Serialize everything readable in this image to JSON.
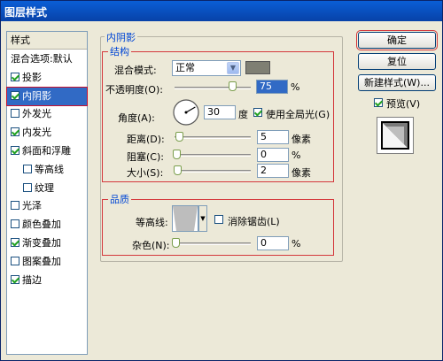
{
  "window": {
    "title": "图层样式"
  },
  "sidebar": {
    "header": "样式",
    "items": [
      {
        "label": "混合选项:默认",
        "checkbox": false,
        "checked": false
      },
      {
        "label": "投影",
        "checkbox": true,
        "checked": true
      },
      {
        "label": "内阴影",
        "checkbox": true,
        "checked": true,
        "selected": true
      },
      {
        "label": "外发光",
        "checkbox": true,
        "checked": false
      },
      {
        "label": "内发光",
        "checkbox": true,
        "checked": true
      },
      {
        "label": "斜面和浮雕",
        "checkbox": true,
        "checked": true
      },
      {
        "label": "等高线",
        "checkbox": true,
        "checked": false,
        "sub": true
      },
      {
        "label": "纹理",
        "checkbox": true,
        "checked": false,
        "sub": true
      },
      {
        "label": "光泽",
        "checkbox": true,
        "checked": false
      },
      {
        "label": "颜色叠加",
        "checkbox": true,
        "checked": false
      },
      {
        "label": "渐变叠加",
        "checkbox": true,
        "checked": true
      },
      {
        "label": "图案叠加",
        "checkbox": true,
        "checked": false
      },
      {
        "label": "描边",
        "checkbox": true,
        "checked": true
      }
    ]
  },
  "inner_shadow": {
    "section_title": "内阴影",
    "structure": {
      "group_title": "结构",
      "blend_mode_label": "混合模式:",
      "blend_mode_value": "正常",
      "shadow_color": "#7f7f73",
      "opacity_label": "不透明度(O):",
      "opacity_value": "75",
      "opacity_unit": "%",
      "opacity_fraction": 0.75,
      "angle_label": "角度(A):",
      "angle_value": "30",
      "angle_unit": "度",
      "global_light_label": "使用全局光(G)",
      "global_light_checked": true,
      "distance_label": "距离(D):",
      "distance_value": "5",
      "distance_unit": "像素",
      "choke_label": "阻塞(C):",
      "choke_value": "0",
      "choke_unit": "%",
      "size_label": "大小(S):",
      "size_value": "2",
      "size_unit": "像素"
    },
    "quality": {
      "group_title": "品质",
      "contour_label": "等高线:",
      "anti_alias_label": "消除锯齿(L)",
      "anti_alias_checked": false,
      "noise_label": "杂色(N):",
      "noise_value": "0",
      "noise_unit": "%"
    }
  },
  "buttons": {
    "ok": "确定",
    "reset": "复位",
    "new_style": "新建样式(W)...",
    "preview_label": "预览(V)",
    "preview_checked": true
  },
  "colors": {
    "accent": "#316ac5",
    "highlight_box": "#d4383c"
  }
}
